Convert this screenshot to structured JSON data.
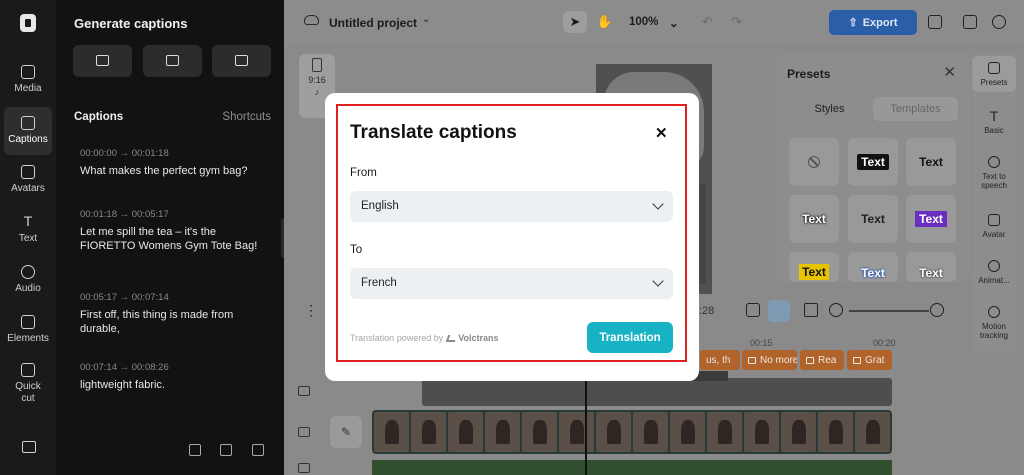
{
  "rail": {
    "items": [
      {
        "label": "Media",
        "icon": "media-icon"
      },
      {
        "label": "Captions",
        "icon": "captions-icon"
      },
      {
        "label": "Avatars",
        "icon": "avatars-icon"
      },
      {
        "label": "Text",
        "icon": "text-icon"
      },
      {
        "label": "Audio",
        "icon": "audio-icon"
      },
      {
        "label": "Elements",
        "icon": "elements-icon"
      },
      {
        "label": "Quick cut",
        "icon": "quick-cut-icon"
      }
    ]
  },
  "panel": {
    "title": "Generate captions",
    "captions_heading": "Captions",
    "shortcuts_label": "Shortcuts",
    "captions": [
      {
        "time": "00:00:00 → 00:01:18",
        "text": "What makes the perfect gym bag?"
      },
      {
        "time": "00:01:18 → 00:05:17",
        "text": "Let me spill the tea – it's the FIORETTO Womens Gym Tote Bag!"
      },
      {
        "time": "00:05:17 → 00:07:14",
        "text": "First off, this thing is made from durable,"
      },
      {
        "time": "00:07:14 → 00:08:26",
        "text": "lightweight fabric."
      }
    ]
  },
  "topbar": {
    "project_title": "Untitled project",
    "zoom": "100%",
    "export_label": "Export",
    "accent_color": "#2b5ea8"
  },
  "stage": {
    "aspect_label": "9:16"
  },
  "presets": {
    "title": "Presets",
    "tab_styles": "Styles",
    "tab_templates": "Templates",
    "tile_text": "Text"
  },
  "right_rail": {
    "items": [
      {
        "label": "Presets"
      },
      {
        "label": "Basic"
      },
      {
        "label": "Text to speech"
      },
      {
        "label": "Avatar"
      },
      {
        "label": "Animat..."
      },
      {
        "label": "Motion tracking"
      }
    ]
  },
  "playbar": {
    "time_fragment": ":28"
  },
  "ruler": {
    "t15": "00:15",
    "t20": "00:20"
  },
  "timeline": {
    "caption_chips": [
      "us, th",
      "No more",
      "Rea",
      "Grat"
    ]
  },
  "modal": {
    "title": "Translate captions",
    "from_label": "From",
    "from_value": "English",
    "to_label": "To",
    "to_value": "French",
    "powered_text": "Translation powered by",
    "powered_brand": "Volctrans",
    "action_label": "Translation",
    "action_color": "#17b3c4",
    "highlight_color": "#e02020"
  }
}
